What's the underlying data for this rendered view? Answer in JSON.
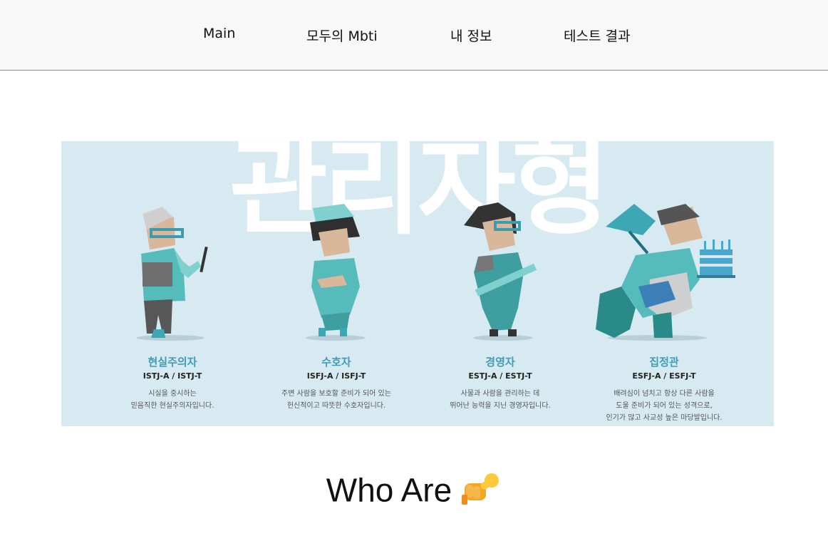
{
  "nav": {
    "items": [
      {
        "label": "Main"
      },
      {
        "label": "모두의 Mbti"
      },
      {
        "label": "내 정보"
      },
      {
        "label": "테스트 결과"
      }
    ]
  },
  "banner": {
    "title": "관리자형",
    "types": [
      {
        "name": "현실주의자",
        "codes": "ISTJ-A / ISTJ-T",
        "desc": "시실을 중시하는\n믿음직한 현실주의자입니다."
      },
      {
        "name": "수호자",
        "codes": "ISFJ-A / ISFJ-T",
        "desc": "주변 사람을 보호할 준비가 되어 있는\n헌신적이고 따뜻한 수호자입니다."
      },
      {
        "name": "경영자",
        "codes": "ESTJ-A / ESTJ-T",
        "desc": "사물과 사람을 관리하는 데\n뛰어난 능력을 지닌 경영자입니다."
      },
      {
        "name": "집정관",
        "codes": "ESFJ-A / ESFJ-T",
        "desc": "배려심이 넘치고 항상 다른 사람을\n도울 준비가 되어 있는 성격으로,\n인기가 많고 사교성 높은 마당발입니다."
      }
    ]
  },
  "section": {
    "heading": "Who Are"
  },
  "colors": {
    "banner_bg": "#d8eaf1",
    "accent": "#3f9bb6",
    "teal": "#5fc1c0"
  }
}
